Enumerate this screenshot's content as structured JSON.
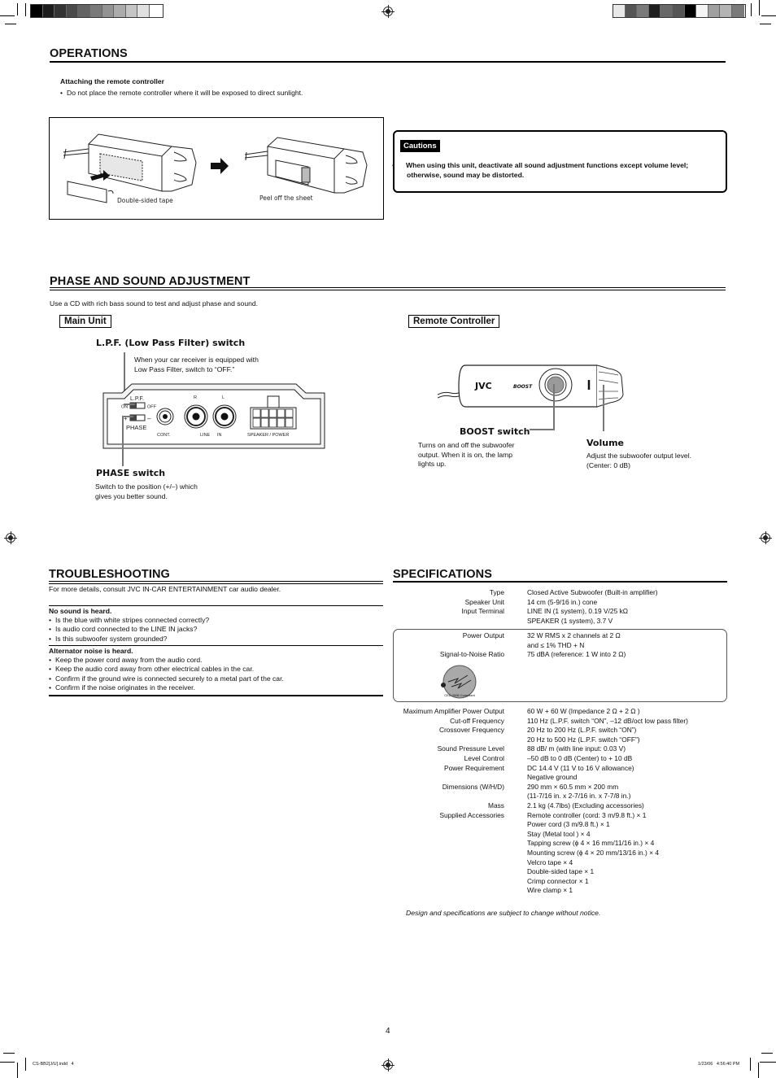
{
  "operations": {
    "title": "OPERATIONS",
    "subheading": "Attaching the remote controller",
    "bullet": "Do not place the remote controller where it will be exposed to direct sunlight.",
    "illustration": {
      "step1_caption": "Double-sided tape",
      "step2_caption": "Peel off the sheet"
    },
    "cautions": {
      "label": "Cautions",
      "text": "When using this unit, deactivate all sound adjustment functions except volume level; otherwise, sound may be distorted."
    }
  },
  "phase": {
    "title": "PHASE AND SOUND ADJUSTMENT",
    "intro": "Use a CD with rich bass sound to test and adjust phase and sound.",
    "main_unit": {
      "label": "Main Unit",
      "lpf_title": "L.P.F. (Low Pass Filter) switch",
      "lpf_desc_1": "When your car receiver is equipped with",
      "lpf_desc_2": "Low Pass Filter, switch to “OFF.”",
      "panel": {
        "lpf": "L.P.F.",
        "on": "ON",
        "off": "OFF",
        "plus": "+",
        "minus": "–",
        "phase": "PHASE",
        "cont": "CONT.",
        "r": "R",
        "l": "L",
        "line": "LINE",
        "in": "IN",
        "speaker_power": "SPEAKER / POWER"
      },
      "phase_title": "PHASE switch",
      "phase_desc_1": "Switch to the position (+/–) which",
      "phase_desc_2": "gives you better sound."
    },
    "remote": {
      "label": "Remote Controller",
      "brand": "JVC",
      "boost_mark": "BOOST",
      "boost_title": "BOOST switch",
      "boost_desc_1": "Turns on and off the subwoofer",
      "boost_desc_2": "output. When it is on, the lamp",
      "boost_desc_3": "lights up.",
      "volume_title": "Volume",
      "volume_desc_1": "Adjust the subwoofer output level.",
      "volume_desc_2": "(Center: 0 dB)"
    }
  },
  "troubleshooting": {
    "title": "TROUBLESHOOTING",
    "intro": "For more details, consult JVC IN-CAR ENTERTAINMENT car audio dealer.",
    "groups": [
      {
        "heading": "No sound is heard.",
        "items": [
          "Is the blue with white stripes connected correctly?",
          "Is audio cord connected to the LINE IN jacks?",
          "Is this subwoofer system grounded?"
        ]
      },
      {
        "heading": "Alternator noise is heard.",
        "items": [
          "Keep the power cord away from the audio cord.",
          "Keep the audio cord away from other electrical cables in the car.",
          "Confirm if the ground wire is connected securely to a metal part of the car.",
          "Confirm if the noise originates in the receiver."
        ]
      }
    ]
  },
  "specifications": {
    "title": "SPECIFICATIONS",
    "rows_top": [
      {
        "label": "Type",
        "value": "Closed Active Subwoofer (Built-in amplifier)"
      },
      {
        "label": "Speaker Unit",
        "value": "14 cm (5-9/16 in.) cone"
      },
      {
        "label": "Input Terminal",
        "value": "LINE IN (1 system), 0.19 V/25 kΩ"
      },
      {
        "label": "",
        "value": "SPEAKER (1 system), 3.7 V"
      }
    ],
    "rows_boxed": [
      {
        "label": "Power Output",
        "value": "32 W RMS x 2 channels at 2 Ω"
      },
      {
        "label": "",
        "value": "and ≤ 1% THD + N"
      },
      {
        "label": "Signal-to-Noise Ratio",
        "value": "75 dBA (reference: 1 W into 2 Ω)"
      }
    ],
    "cea_badge": "CEA-2006 Compliant",
    "rows_bottom": [
      {
        "label": "Maximum Amplifier Power Output",
        "value": "60 W + 60 W (Impedance 2 Ω + 2 Ω )"
      },
      {
        "label": "Cut-off Frequency",
        "value": "110 Hz (L.P.F. switch “ON”, –12 dB/oct low pass filter)"
      },
      {
        "label": "Crossover Frequency",
        "value": "20 Hz to 200 Hz (L.P.F. switch “ON”)"
      },
      {
        "label": "",
        "value": "20 Hz to 500 Hz (L.P.F. switch “OFF”)"
      },
      {
        "label": "Sound Pressure Level",
        "value": "88 dB/ m (with line input: 0.03 V)"
      },
      {
        "label": "Level Control",
        "value": "–50 dB to 0 dB (Center) to + 10 dB"
      },
      {
        "label": "Power Requirement",
        "value": "DC 14.4 V (11 V to 16 V allowance)"
      },
      {
        "label": "",
        "value": "Negative ground"
      },
      {
        "label": "Dimensions (W/H/D)",
        "value": "290 mm × 60.5 mm × 200 mm"
      },
      {
        "label": "",
        "value": "(11-7/16 in. x 2-7/16 in. x 7-7/8 in.)"
      },
      {
        "label": "Mass",
        "value": "2.1 kg (4.7lbs) (Excluding accessories)"
      },
      {
        "label": "Supplied Accessories",
        "value": "Remote controller (cord: 3 m/9.8 ft.) × 1"
      },
      {
        "label": "",
        "value": "Power cord (3 m/9.8 ft.) × 1"
      },
      {
        "label": "",
        "value": "Stay (Metal tool ) × 4"
      },
      {
        "label": "",
        "value": "Tapping screw (ϕ 4 × 16 mm/11/16 in.) × 4"
      },
      {
        "label": "",
        "value": "Mounting screw (ϕ 4 × 20 mm/13/16 in.) × 4"
      },
      {
        "label": "",
        "value": "Velcro tape × 4"
      },
      {
        "label": "",
        "value": "Double-sided tape × 1"
      },
      {
        "label": "",
        "value": "Crimp connector × 1"
      },
      {
        "label": "",
        "value": "Wire clamp × 1"
      }
    ],
    "footnote": "Design and specifications are subject to change without notice."
  },
  "page_number": "4",
  "footer": {
    "file": "CS-BB2[J/U].indd   4",
    "timestamp": "1/23/06   4:56:40 PM"
  },
  "colors": {
    "swatches_left": [
      "#000000",
      "#1c1c1c",
      "#333333",
      "#4a4a4a",
      "#636363",
      "#7a7a7a",
      "#939393",
      "#ababab",
      "#c5c5c5",
      "#e0e0e0",
      "#ffffff"
    ],
    "swatches_right": [
      "#e8e8e8",
      "#555555",
      "#7a7a7a",
      "#1e1e1e",
      "#686868",
      "#555555",
      "#000000",
      "#f4f4f4",
      "#a0a0a0",
      "#b4b4b4",
      "#7a7a7a"
    ]
  }
}
